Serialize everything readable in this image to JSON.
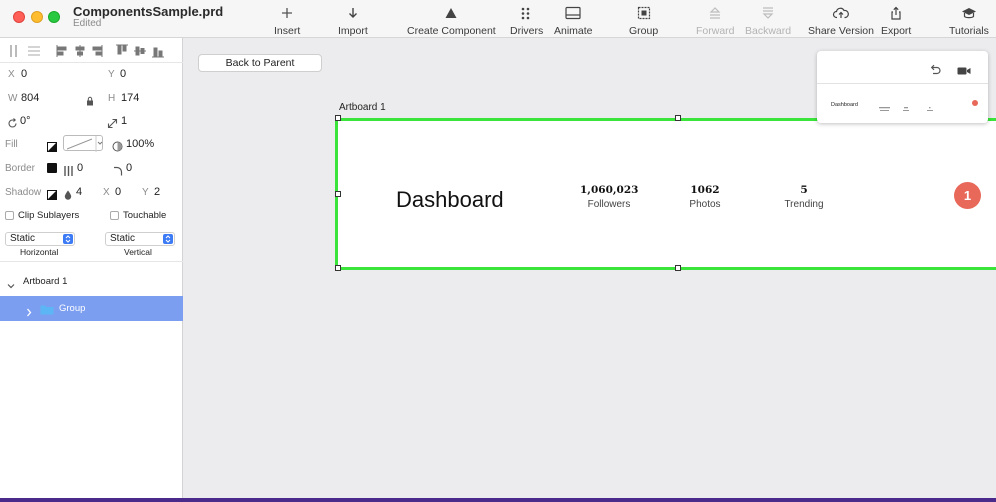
{
  "window": {
    "title": "ComponentsSample.prd",
    "subtitle": "Edited"
  },
  "toolbar": {
    "insert": "Insert",
    "import": "Import",
    "create_component": "Create Component",
    "drivers": "Drivers",
    "animate": "Animate",
    "group": "Group",
    "forward": "Forward",
    "backward": "Backward",
    "share_version": "Share Version",
    "export": "Export",
    "tutorials": "Tutorials"
  },
  "inspector": {
    "x_label": "X",
    "x_value": "0",
    "y_label": "Y",
    "y_value": "0",
    "w_label": "W",
    "w_value": "804",
    "h_label": "H",
    "h_value": "174",
    "rotation_value": "0°",
    "scale_value": "1",
    "fill_label": "Fill",
    "fill_opacity": "100%",
    "border_label": "Border",
    "border_width": "0",
    "border_radius": "0",
    "shadow_label": "Shadow",
    "shadow_blur": "4",
    "shadow_x_label": "X",
    "shadow_x_value": "0",
    "shadow_y_label": "Y",
    "shadow_y_value": "2",
    "clip_sublayers": "Clip Sublayers",
    "touchable": "Touchable",
    "horizontal_value": "Static",
    "horizontal_label": "Horizontal",
    "vertical_value": "Static",
    "vertical_label": "Vertical"
  },
  "layers": {
    "artboard": "Artboard 1",
    "group": "Group"
  },
  "canvas": {
    "back_button": "Back to Parent",
    "artboard_label": "Artboard 1",
    "dashboard_title": "Dashboard",
    "stats": [
      {
        "value": "1,060,023",
        "label": "Followers"
      },
      {
        "value": "1062",
        "label": "Photos"
      },
      {
        "value": "5",
        "label": "Trending"
      }
    ],
    "badge_count": "1"
  },
  "preview": {
    "title": "Dashboard"
  },
  "colors": {
    "selection_green": "#3ae43a",
    "badge_red": "#e8685a",
    "layer_selection": "#7b9ef0",
    "accent_blue": "#3d7bf5"
  }
}
